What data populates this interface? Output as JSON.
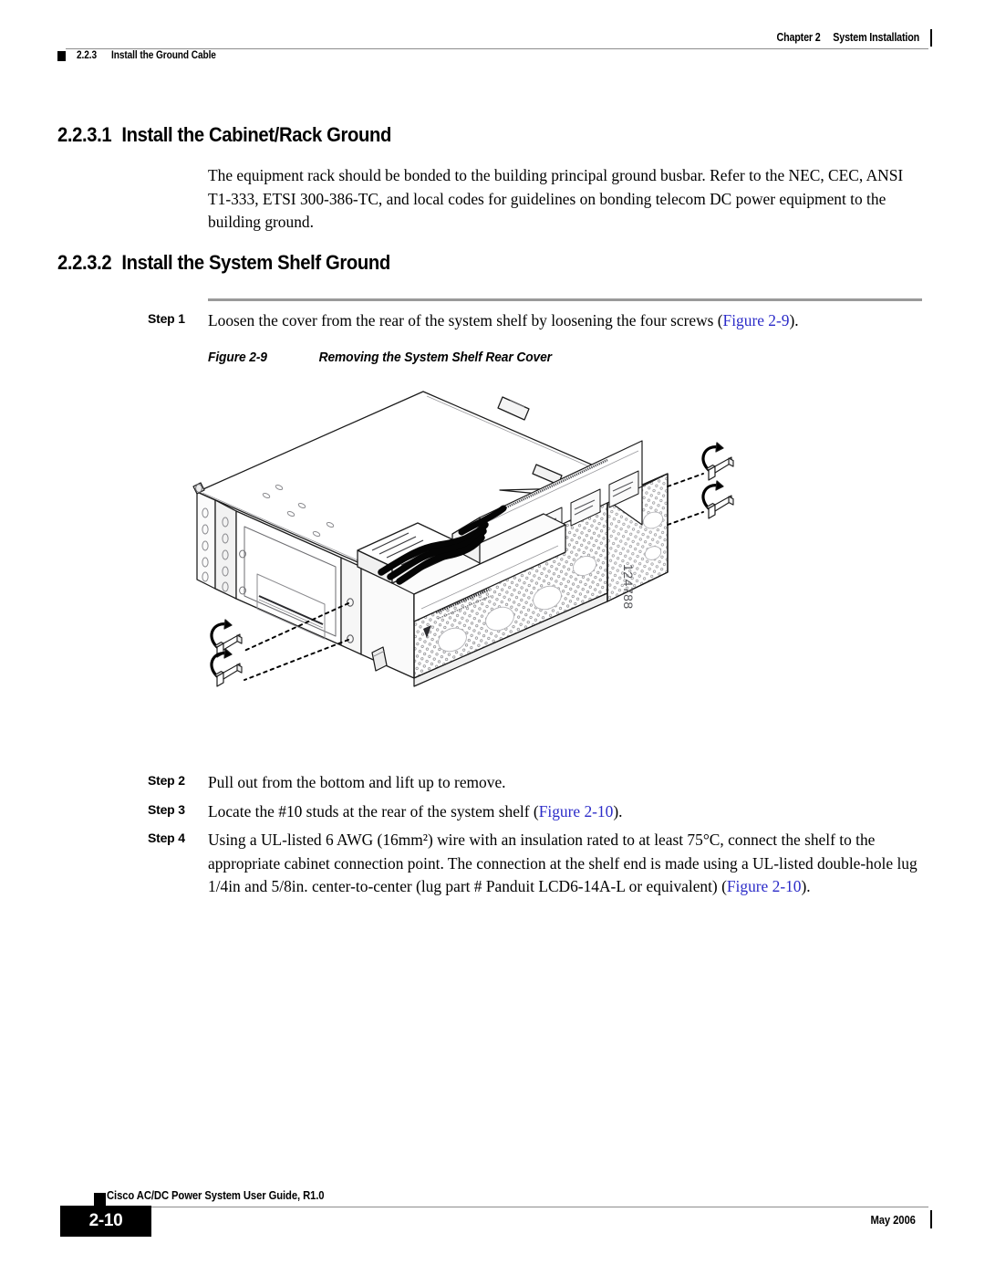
{
  "header": {
    "chapter": "Chapter 2",
    "chapter_title": "System Installation",
    "section_number": "2.2.3",
    "section_title": "Install the Ground Cable"
  },
  "sections": [
    {
      "number": "2.2.3.1",
      "title": "Install the Cabinet/Rack Ground",
      "body": "The equipment rack should be bonded to the building principal ground busbar. Refer to the NEC, CEC, ANSI T1-333, ETSI 300-386-TC, and local codes for guidelines on bonding telecom DC power equipment to the building ground."
    },
    {
      "number": "2.2.3.2",
      "title": "Install the System Shelf Ground"
    }
  ],
  "steps": [
    {
      "label": "Step 1",
      "text_before": "Loosen the cover from the rear of the system shelf by loosening the four screws (",
      "xref": "Figure 2-9",
      "text_after": ")."
    },
    {
      "label": "Step 2",
      "text_before": "Pull out from the bottom and lift up to remove.",
      "xref": "",
      "text_after": ""
    },
    {
      "label": "Step 3",
      "text_before": "Locate the #10 studs at the rear of the system shelf (",
      "xref": "Figure 2-10",
      "text_after": ")."
    },
    {
      "label": "Step 4",
      "text_before": "Using a UL-listed 6 AWG (16mm²) wire with an insulation rated to at least 75°C, connect the shelf to the appropriate cabinet connection point. The connection at the shelf end is made using a UL-listed double-hole lug 1/4in and 5/8in. center-to-center (lug part # Panduit LCD6-14A-L or equivalent) (",
      "xref": "Figure 2-10",
      "text_after": ")."
    }
  ],
  "figure": {
    "number": "Figure 2-9",
    "title": "Removing the System Shelf Rear Cover",
    "artwork_id": "124788",
    "description": "Isometric line drawing of the system shelf showing the rear cover and the four captive screws being unscrewed"
  },
  "footer": {
    "guide_title": "Cisco AC/DC Power System User Guide, R1.0",
    "page_number": "2-10",
    "date": "May 2006"
  },
  "colors": {
    "xref": "#2b2bc8",
    "rule": "#8c8c8c",
    "step_rule": "#9a9a9a",
    "artwork_id": "#55565a",
    "text": "#000000",
    "page_background": "#ffffff"
  }
}
